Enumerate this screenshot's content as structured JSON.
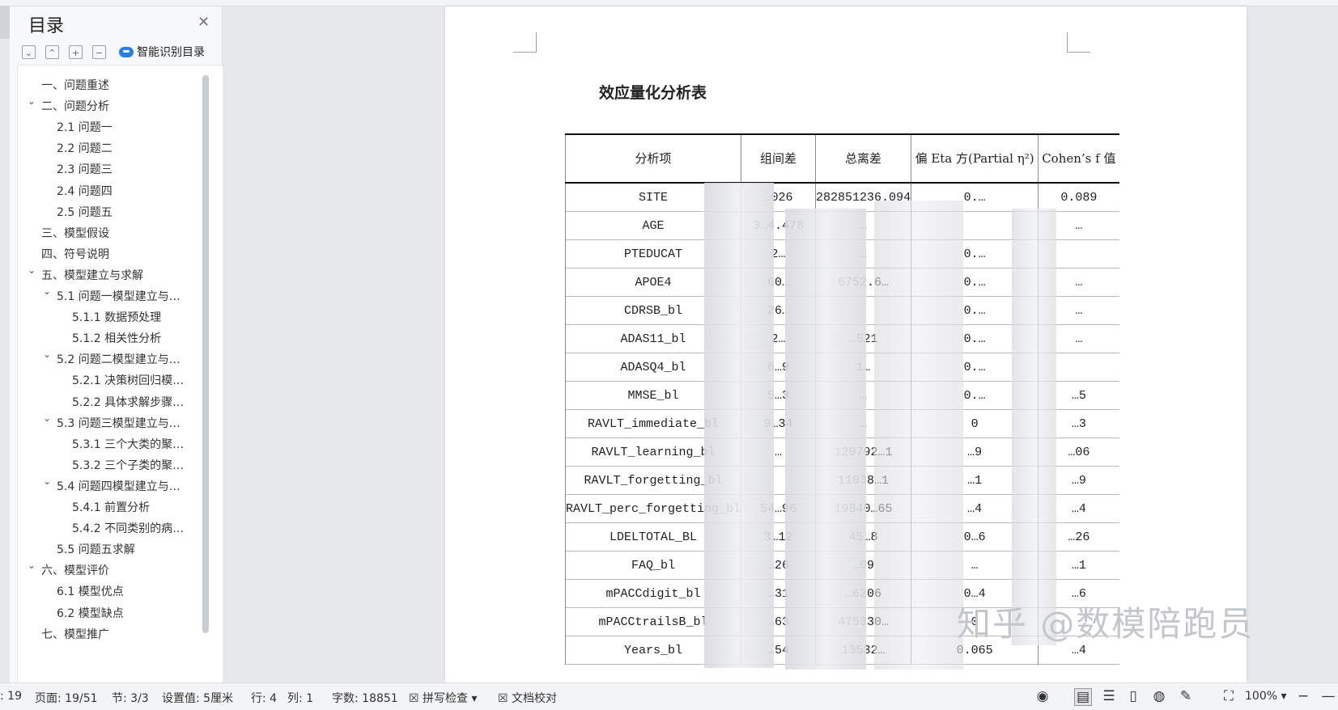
{
  "nav": {
    "title": "目录",
    "smart_label": "智能识别目录",
    "items": [
      {
        "label": "一、问题重述",
        "level": 1,
        "expanded": false
      },
      {
        "label": "二、问题分析",
        "level": 1,
        "expanded": true
      },
      {
        "label": "2.1 问题一",
        "level": 2
      },
      {
        "label": "2.2 问题二",
        "level": 2
      },
      {
        "label": "2.3 问题三",
        "level": 2
      },
      {
        "label": "2.4 问题四",
        "level": 2
      },
      {
        "label": "2.5 问题五",
        "level": 2
      },
      {
        "label": "三、模型假设",
        "level": 1
      },
      {
        "label": "四、符号说明",
        "level": 1
      },
      {
        "label": "五、模型建立与求解",
        "level": 1,
        "expanded": true
      },
      {
        "label": "5.1 问题一模型建立与…",
        "level": 2,
        "expanded": true
      },
      {
        "label": "5.1.1  数据预处理",
        "level": 3
      },
      {
        "label": "5.1.2  相关性分析",
        "level": 3
      },
      {
        "label": "5.2 问题二模型建立与…",
        "level": 2,
        "expanded": true
      },
      {
        "label": "5.2.1 决策树回归模…",
        "level": 3
      },
      {
        "label": "5.2.2  具体求解步骤…",
        "level": 3
      },
      {
        "label": "5.3 问题三模型建立与…",
        "level": 2,
        "expanded": true
      },
      {
        "label": "5.3.1  三个大类的聚…",
        "level": 3
      },
      {
        "label": "5.3.2  三个子类的聚…",
        "level": 3
      },
      {
        "label": "5.4  问题四模型建立与…",
        "level": 2,
        "expanded": true
      },
      {
        "label": "5.4.1 前置分析",
        "level": 3
      },
      {
        "label": "5.4.2 不同类别的病…",
        "level": 3
      },
      {
        "label": "5.5  问题五求解",
        "level": 2
      },
      {
        "label": "六、模型评价",
        "level": 1,
        "expanded": true
      },
      {
        "label": "6.1  模型优点",
        "level": 2
      },
      {
        "label": "6.2  模型缺点",
        "level": 2
      },
      {
        "label": "七、模型推广",
        "level": 1
      }
    ]
  },
  "doc": {
    "title": "效应量化分析表",
    "table": {
      "headers": [
        "分析项",
        "组间差",
        "总离差",
        "偏 Eta 方(Partial η²)",
        "Cohen’s f 值"
      ],
      "rows": [
        [
          "SITE",
          "…026",
          "282851236.094",
          "0.…",
          "0.089"
        ],
        [
          "AGE",
          "3…4.478",
          "…",
          "",
          "…"
        ],
        [
          "PTEDUCAT",
          "2…",
          "…",
          "0.…",
          ""
        ],
        [
          "APOE4",
          "60…",
          "6752.6…",
          "0.…",
          "…"
        ],
        [
          "CDRSB_bl",
          "26…",
          "",
          "0.…",
          "…"
        ],
        [
          "ADAS11_bl",
          "2…",
          "…521",
          "0.…",
          "…"
        ],
        [
          "ADASQ4_bl",
          "6…9",
          "1…",
          "0.…",
          ""
        ],
        [
          "MMSE_bl",
          "5…3",
          "…",
          "0.…",
          "…5"
        ],
        [
          "RAVLT_immediate_bl",
          "9…34",
          "…",
          "0",
          "…3"
        ],
        [
          "RAVLT_learning_bl",
          "…",
          "120792…1",
          "…9",
          "…06"
        ],
        [
          "RAVLT_forgetting_bl",
          "",
          "11038…1",
          "…1",
          "…9"
        ],
        [
          "RAVLT_perc_forgetting_bl",
          "54…96",
          "19840…65",
          "…4",
          "…4"
        ],
        [
          "LDELTOTAL_BL",
          "3…12",
          "45…8",
          "0…6",
          "…26"
        ],
        [
          "FAQ_bl",
          "…26",
          "…09",
          "…",
          "…1"
        ],
        [
          "mPACCdigit_bl",
          "…31",
          "…6206",
          "0…4",
          "…6"
        ],
        [
          "mPACCtrailsB_bl",
          "…63",
          "475330…",
          "0",
          ""
        ],
        [
          "Years_bl",
          "…54",
          "13532…",
          "0.065",
          "…4"
        ]
      ]
    },
    "watermark": "知乎 @数模陪跑员"
  },
  "status": {
    "page_count_label": ": 19",
    "page_label": "页面: 19/51",
    "section_label": "节: 3/3",
    "setting_label": "设置值: 5厘米",
    "row_label": "行: 4",
    "col_label": "列: 1",
    "word_count_label": "字数: 18851",
    "spell_check_label": "拼写检查",
    "doc_check_label": "文档校对",
    "zoom_label": "100%"
  }
}
